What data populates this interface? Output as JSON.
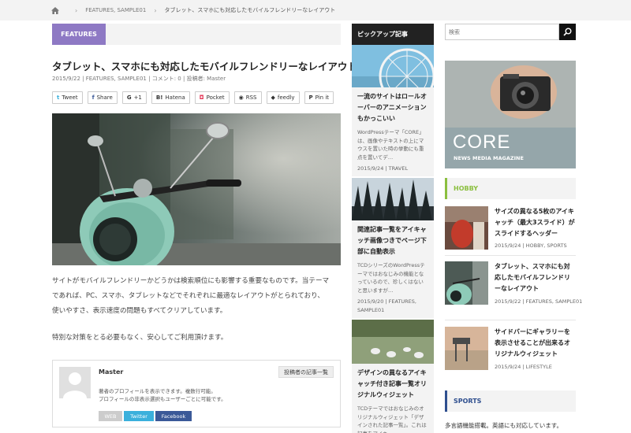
{
  "breadcrumb": {
    "category": "FEATURES, SAMPLE01",
    "current": "タブレット、スマホにも対応したモバイルフレンドリーなレイアウト"
  },
  "article": {
    "category_label": "FEATURES",
    "title": "タブレット、スマホにも対応したモバイルフレンドリーなレイアウト",
    "date": "2015/9/22",
    "categories": "FEATURES, SAMPLE01",
    "comments": "コメント: 0",
    "author": "投稿者: Master",
    "share_buttons": [
      {
        "icon": "tweet-icon",
        "glyph": "t",
        "label": "Tweet"
      },
      {
        "icon": "facebook-icon",
        "glyph": "f",
        "label": "Share"
      },
      {
        "icon": "google-plus-icon",
        "glyph": "G",
        "label": "+1"
      },
      {
        "icon": "hatena-icon",
        "glyph": "B!",
        "label": "Hatena"
      },
      {
        "icon": "pocket-icon",
        "glyph": "◘",
        "label": "Pocket"
      },
      {
        "icon": "rss-icon",
        "glyph": "◉",
        "label": "RSS"
      },
      {
        "icon": "feedly-icon",
        "glyph": "◆",
        "label": "feedly"
      },
      {
        "icon": "pinterest-icon",
        "glyph": "P",
        "label": "Pin it"
      }
    ],
    "body_line1": "サイトがモバイルフレンドリーかどうかは検索順位にも影響する重要なものです。当テーマ",
    "body_line2": "であれば、PC、スマホ、タブレットなどでそれぞれに最適なレイアウトがとられており、",
    "body_line3": "使いやすさ、表示速度の問題もすべてクリアしています。",
    "body_line4": "特別な対策をとる必要もなく、安心してご利用頂けます。"
  },
  "author_box": {
    "name": "Master",
    "posts_button": "投稿者の記事一覧",
    "desc_line1": "著者のプロフィールを表示できます。複数行可能。",
    "desc_line2": "プロフィールの非表示選択もユーザーごとに可能です。",
    "link_web": "WEB",
    "link_twitter": "Twitter",
    "link_facebook": "Facebook"
  },
  "pickup": {
    "heading": "ピックアップ記事",
    "items": [
      {
        "title": "一流のサイトはロールオーバーのアニメーションもかっこいい",
        "excerpt": "WordPressテーマ「CORE」は、画像やテキストの上にマウスを置いた時の挙動にも重点を置いてデ…",
        "meta": "2015/9/24 | TRAVEL"
      },
      {
        "title": "関連記事一覧をアイキャッチ画像つきでページ下部に自動表示",
        "excerpt": "TCDシリーズのWordPressテーマではおなじみの機能となっているので、珍しくはないと思いますが…",
        "meta": "2015/9/20 | FEATURES, SAMPLE01"
      },
      {
        "title": "デザインの異なるアイキャッチ付き記事一覧オリジナルウィジェット",
        "excerpt": "TCDテーマではおなじみのオリジナルウィジェット「デザインされた記事一覧」。これは記事をアイキ…",
        "meta": ""
      }
    ]
  },
  "sidebar": {
    "search_placeholder": "検索",
    "banner_title": "CORE",
    "banner_sub": "NEWS MEDIA MAGAZINE",
    "hobby_heading": "HOBBY",
    "hobby_color": "#8bbf3f",
    "hobby_items": [
      {
        "title": "サイズの異なる5枚のアイキャッチ（最大3スライド）がスライドするヘッダー",
        "meta": "2015/9/24 | HOBBY, SPORTS"
      },
      {
        "title": "タブレット、スマホにも対応したモバイルフレンドリーなレイアウト",
        "meta": "2015/9/22 | FEATURES, SAMPLE01"
      },
      {
        "title": "サイドバーにギャラリーを表示させることが出来るオリジナルウィジェット",
        "meta": "2015/9/24 | LIFESTYLE"
      }
    ],
    "sports_heading": "SPORTS",
    "sports_color": "#2f4f8f",
    "sports_text": "多言語機能搭載。英語にも対応しています。"
  },
  "colors": {
    "accent_purple": "#8e79c4",
    "twitter": "#3bb0dc",
    "facebook": "#3b5998"
  }
}
